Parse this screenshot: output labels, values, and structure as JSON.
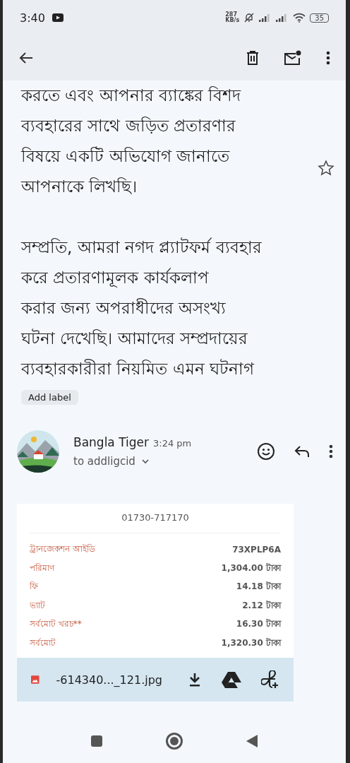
{
  "status_bar": {
    "time": "3:40",
    "speed_value": "287",
    "speed_unit": "KB/s",
    "battery": "35"
  },
  "body": {
    "paragraphs": [
      [
        "করতে এবং আপনার ব্যাঙ্কের বিশদ",
        "ব্যবহারের সাথে জড়িত প্রতারণার",
        "বিষয়ে একটি অভিযোগ জানাতে",
        "আপনাকে লিখছি।"
      ],
      [
        "সম্প্রতি, আমরা নগদ প্ল্যাটফর্ম ব্যবহার",
        "করে প্রতারণামূলক কার্যকলাপ",
        "করার জন্য অপরাধীদের অসংখ্য",
        "ঘটনা দেখেছি। আমাদের সম্প্রদায়ের",
        "ব্যবহারকারীরা নিয়মিত এমন ঘটনাগ"
      ]
    ],
    "starred": false
  },
  "label_chip": "Add label",
  "message": {
    "sender": "Bangla Tiger",
    "time": "3:24 pm",
    "recipient": "to addligcid"
  },
  "attachment": {
    "phone": "01730-717170",
    "rows": [
      {
        "label": "ট্রানজেকশন আইডি",
        "value": "73XPLP6A"
      },
      {
        "label": "পরিমাণ",
        "value": "1,304.00 টাকা"
      },
      {
        "label": "ফি",
        "value": "14.18 টাকা"
      },
      {
        "label": "ভ্যাট",
        "value": "2.12 টাকা"
      },
      {
        "label": "সর্বমোট খরচ**",
        "value": "16.30 টাকা"
      },
      {
        "label": "সর্বমোট",
        "value": "1,320.30 টাকা"
      }
    ],
    "filename": "-614340..._121.jpg"
  }
}
